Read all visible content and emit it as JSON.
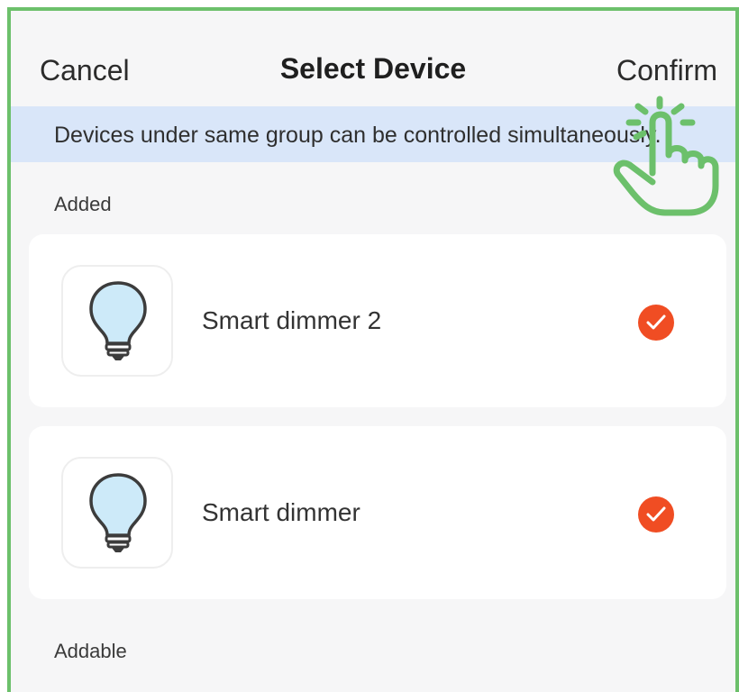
{
  "nav": {
    "cancel_label": "Cancel",
    "title": "Select Device",
    "confirm_label": "Confirm"
  },
  "banner": {
    "text": "Devices under same group can be controlled simultaneously."
  },
  "sections": {
    "added_label": "Added",
    "addable_label": "Addable"
  },
  "devices": [
    {
      "name": "Smart dimmer 2",
      "icon": "light-bulb-icon",
      "selected": true
    },
    {
      "name": "Smart dimmer",
      "icon": "light-bulb-icon",
      "selected": true
    }
  ],
  "colors": {
    "background": "#f6f6f7",
    "banner": "#d9e6f9",
    "check": "#f04d23",
    "frame": "#6cc06b",
    "bulb": "#cdeaf9"
  },
  "overlay_icon": "tap-hand-icon"
}
